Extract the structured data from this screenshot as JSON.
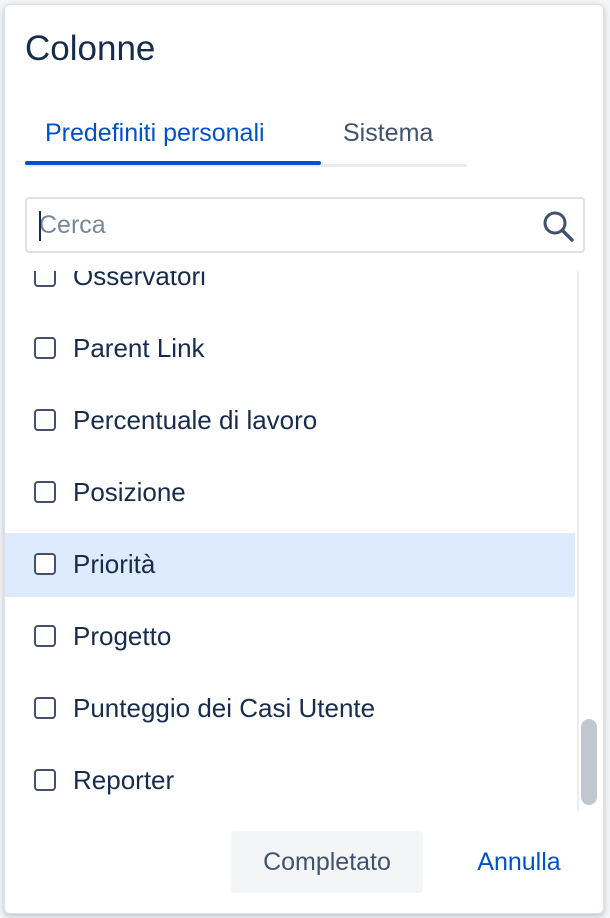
{
  "dialog": {
    "title": "Colonne"
  },
  "tabs": [
    {
      "label": "Predefiniti personali",
      "active": true
    },
    {
      "label": "Sistema",
      "active": false
    }
  ],
  "search": {
    "placeholder": "Cerca",
    "value": "",
    "icon": "search-icon"
  },
  "columns": [
    {
      "label": "Osservatori",
      "checked": false,
      "highlighted": false
    },
    {
      "label": "Parent Link",
      "checked": false,
      "highlighted": false
    },
    {
      "label": "Percentuale di lavoro",
      "checked": false,
      "highlighted": false
    },
    {
      "label": "Posizione",
      "checked": false,
      "highlighted": false
    },
    {
      "label": "Priorità",
      "checked": false,
      "highlighted": true
    },
    {
      "label": "Progetto",
      "checked": false,
      "highlighted": false
    },
    {
      "label": "Punteggio dei Casi Utente",
      "checked": false,
      "highlighted": false
    },
    {
      "label": "Reporter",
      "checked": false,
      "highlighted": false
    }
  ],
  "footer": {
    "done_label": "Completato",
    "cancel_label": "Annulla"
  },
  "colors": {
    "accent": "#0052cc",
    "highlight": "#deebff",
    "text": "#172b4d",
    "muted": "#42526e"
  }
}
